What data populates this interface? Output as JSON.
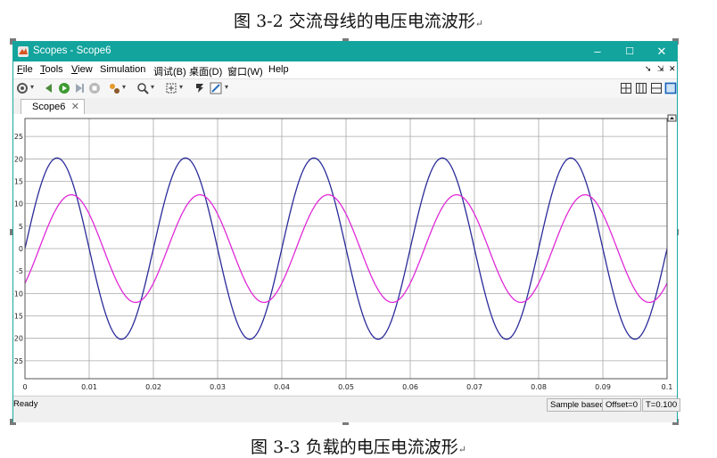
{
  "document": {
    "caption_top": "图 3-2 交流母线的电压电流波形",
    "caption_bottom": "图 3-3 负载的电压电流波形",
    "paragraph_mark": "↵"
  },
  "window": {
    "title": "Scopes - Scope6",
    "min_symbol": "–",
    "max_symbol": "☐",
    "close_symbol": "✕"
  },
  "menu": {
    "items": [
      {
        "accel": "F",
        "rest": "ile"
      },
      {
        "accel": "T",
        "rest": "ools"
      },
      {
        "accel": "V",
        "rest": "iew"
      },
      {
        "accel": "",
        "rest": "Simulation"
      },
      {
        "accel": "",
        "rest": "调试(B)"
      },
      {
        "accel": "",
        "rest": "桌面(D)"
      },
      {
        "accel": "",
        "rest": "窗口(W)"
      },
      {
        "accel": "",
        "rest": "Help"
      }
    ],
    "right_glyphs": [
      "➘",
      "⇲",
      "✕"
    ]
  },
  "toolbar": {
    "icons": [
      "settings-icon",
      "step-back-icon",
      "run-icon",
      "step-forward-icon",
      "stop-icon",
      "highlight-icon",
      "zoom-icon",
      "autoscale-icon",
      "cursor-icon",
      "style-icon"
    ],
    "layout_icons": [
      "layout-grid-icon",
      "layout-columns-icon",
      "layout-rows-icon",
      "layout-single-icon"
    ]
  },
  "tab": {
    "label": "Scope6",
    "close": "✕"
  },
  "status": {
    "ready": "Ready",
    "sample_based": "Sample based",
    "offset": "Offset=0",
    "time": "T=0.100"
  },
  "colors": {
    "voltage": "#2b2b9a",
    "current": "#e02ad8",
    "title_bar": "#12a49d"
  },
  "chart_data": {
    "type": "line",
    "title": "",
    "xlabel": "",
    "ylabel": "",
    "xlim": [
      0,
      0.1
    ],
    "ylim": [
      -29,
      29
    ],
    "x_ticks": [
      0,
      0.01,
      0.02,
      0.03,
      0.04,
      0.05,
      0.06,
      0.07,
      0.08,
      0.09,
      0.1
    ],
    "x_tick_labels": [
      "0",
      "0.01",
      "0.02",
      "0.03",
      "0.04",
      "0.05",
      "0.06",
      "0.07",
      "0.08",
      "0.09",
      "0.1"
    ],
    "y_ticks": [
      25,
      20,
      15,
      10,
      5,
      0,
      -5,
      -10,
      -15,
      -20,
      -25
    ],
    "y_tick_labels": [
      "25",
      "20",
      "15",
      "10",
      "5",
      "0",
      "-5",
      "-10",
      "-15",
      "-20",
      "-25"
    ],
    "grid": true,
    "legend": "none",
    "series": [
      {
        "color": "#2b2b9a",
        "amplitude": 20.2,
        "frequency_hz": 50,
        "phase_deg": 0,
        "x": [
          0,
          0.0025,
          0.005,
          0.0075,
          0.01,
          0.0125,
          0.015,
          0.0175,
          0.02
        ],
        "values": [
          0,
          14.3,
          20.2,
          14.3,
          0,
          -14.3,
          -20.2,
          -14.3,
          0
        ]
      },
      {
        "color": "#e02ad8",
        "amplitude": 12.0,
        "frequency_hz": 50,
        "phase_deg": -40,
        "x": [
          0,
          0.0025,
          0.005,
          0.0075,
          0.01,
          0.0125,
          0.015,
          0.0175,
          0.02
        ],
        "values": [
          -7.7,
          1.4,
          10.1,
          12.0,
          7.7,
          -1.4,
          -10.1,
          -12.0,
          -7.7
        ]
      }
    ]
  }
}
